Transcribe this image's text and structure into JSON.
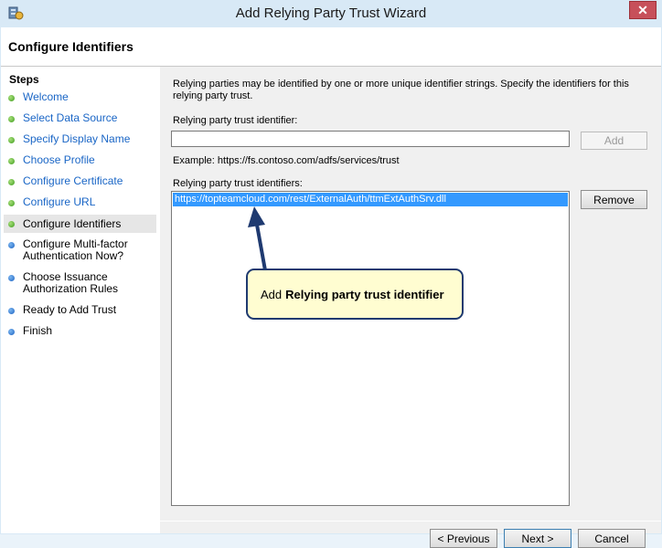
{
  "window": {
    "title": "Add Relying Party Trust Wizard",
    "close_glyph": "✕",
    "app_icon": "server-wizard-icon",
    "close_icon": "close-icon"
  },
  "header": {
    "title": "Configure Identifiers"
  },
  "steps": {
    "heading": "Steps",
    "items": [
      {
        "label": "Welcome",
        "status": "complete"
      },
      {
        "label": "Select Data Source",
        "status": "complete"
      },
      {
        "label": "Specify Display Name",
        "status": "complete"
      },
      {
        "label": "Choose Profile",
        "status": "complete"
      },
      {
        "label": "Configure Certificate",
        "status": "complete"
      },
      {
        "label": "Configure URL",
        "status": "complete"
      },
      {
        "label": "Configure Identifiers",
        "status": "current"
      },
      {
        "label": "Configure Multi-factor Authentication Now?",
        "status": "pending"
      },
      {
        "label": "Choose Issuance Authorization Rules",
        "status": "pending"
      },
      {
        "label": "Ready to Add Trust",
        "status": "pending"
      },
      {
        "label": "Finish",
        "status": "pending"
      }
    ]
  },
  "main": {
    "description": "Relying parties may be identified by one or more unique identifier strings. Specify the identifiers for this relying party trust.",
    "identifier_label": "Relying party trust identifier:",
    "identifier_value": "",
    "add_label": "Add",
    "example": "Example: https://fs.contoso.com/adfs/services/trust",
    "identifiers_label": "Relying party trust identifiers:",
    "identifiers": [
      "https://topteamcloud.com/rest/ExternalAuth/ttmExtAuthSrv.dll"
    ],
    "remove_label": "Remove"
  },
  "callout": {
    "prefix": "Add",
    "bold": "Relying party trust identifier"
  },
  "footer": {
    "previous_label": "< Previous",
    "next_label": "Next >",
    "cancel_label": "Cancel"
  },
  "colors": {
    "selection": "#3399ff",
    "callout_bg": "#fffdd1",
    "callout_border": "#1f3a70",
    "link": "#1a66c6"
  }
}
